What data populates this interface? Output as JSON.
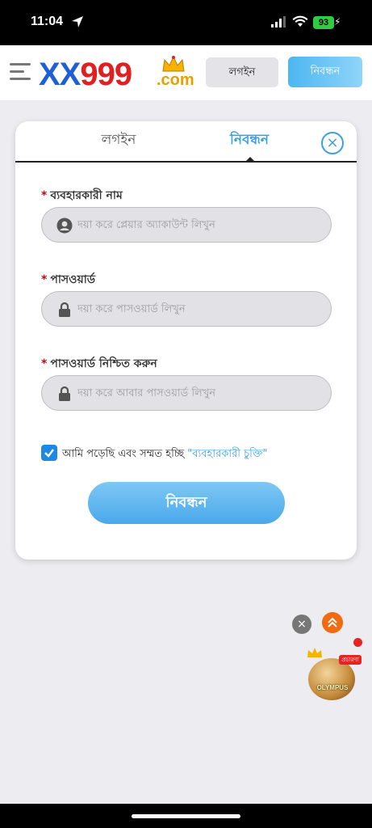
{
  "status_bar": {
    "time": "11:04",
    "battery": "93"
  },
  "header": {
    "logo_xx": "XX",
    "logo_999": "999",
    "logo_com": ".com",
    "login_label": "লগইন",
    "register_label": "নিবন্ধন"
  },
  "card": {
    "tab_login": "লগইন",
    "tab_register": "নিবন্ধন",
    "close_glyph": "×"
  },
  "form": {
    "username_label": "ব্যবহারকারী নাম",
    "username_placeholder": "দয়া করে প্লেয়ার অ্যাকাউন্ট লিখুন",
    "password_label": "পাসওয়ার্ড",
    "password_placeholder": "দয়া করে পাসওয়ার্ড লিখুন",
    "confirm_label": "পাসওয়ার্ড নিশ্চিত করুন",
    "confirm_placeholder": "দয়া করে আবার পাসওয়ার্ড লিখুন",
    "required_mark": "*",
    "agree_text": "আমি পড়েছি এবং সম্মত হচ্ছি",
    "agree_link": "\"ব্যবহারকারী চুক্তি\"",
    "agree_checked": true,
    "submit_label": "নিবন্ধন"
  },
  "floating": {
    "promo_tag": "প্রচারণা",
    "promo_label": "OLYMPUS",
    "close_glyph": "×"
  },
  "colors": {
    "accent": "#3aa0e0",
    "brand_blue": "#1e5fd6",
    "brand_red": "#e02020",
    "required": "#d0021b"
  }
}
